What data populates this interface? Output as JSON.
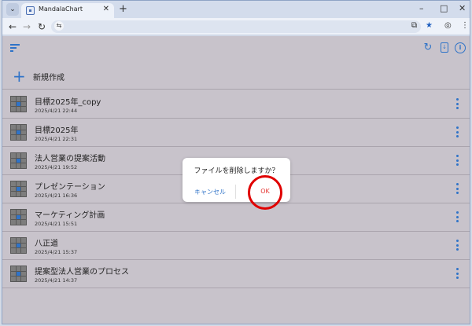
{
  "browser": {
    "tab_title": "MandalaChart",
    "tab_close": "✕",
    "new_tab": "+",
    "tab_menu": "⌄",
    "window_controls": {
      "minimize": "–",
      "maximize": "□",
      "close": "✕"
    },
    "nav": {
      "back": "←",
      "forward": "→",
      "reload": "↻"
    },
    "omnibox_icon": "⇆",
    "right_icons": {
      "cast": "⧉",
      "star": "★",
      "profile": "◎",
      "menu": "⋮"
    }
  },
  "app": {
    "top_icons": {
      "refresh": "↻",
      "doc": "↓",
      "info": "i"
    },
    "new_item": {
      "plus": "+",
      "label": "新規作成"
    },
    "items": [
      {
        "title": "目標2025年_copy",
        "date": "2025/4/21 22:44"
      },
      {
        "title": "目標2025年",
        "date": "2025/4/21 22:31"
      },
      {
        "title": "法人営業の提案活動",
        "date": "2025/4/21 19:52"
      },
      {
        "title": "プレゼンテーション",
        "date": "2025/4/21 16:36"
      },
      {
        "title": "マーケティング計画",
        "date": "2025/4/21 15:51"
      },
      {
        "title": "八正道",
        "date": "2025/4/21 15:37"
      },
      {
        "title": "提案型法人営業のプロセス",
        "date": "2025/4/21 14:37"
      }
    ]
  },
  "dialog": {
    "title": "ファイルを削除しますか？",
    "cancel_label": "キャンセル",
    "ok_label": "OK"
  },
  "colors": {
    "accent": "#2f73c8",
    "ok": "#e53935",
    "highlight": "#e00000",
    "app_bg": "#c8c3cb"
  }
}
